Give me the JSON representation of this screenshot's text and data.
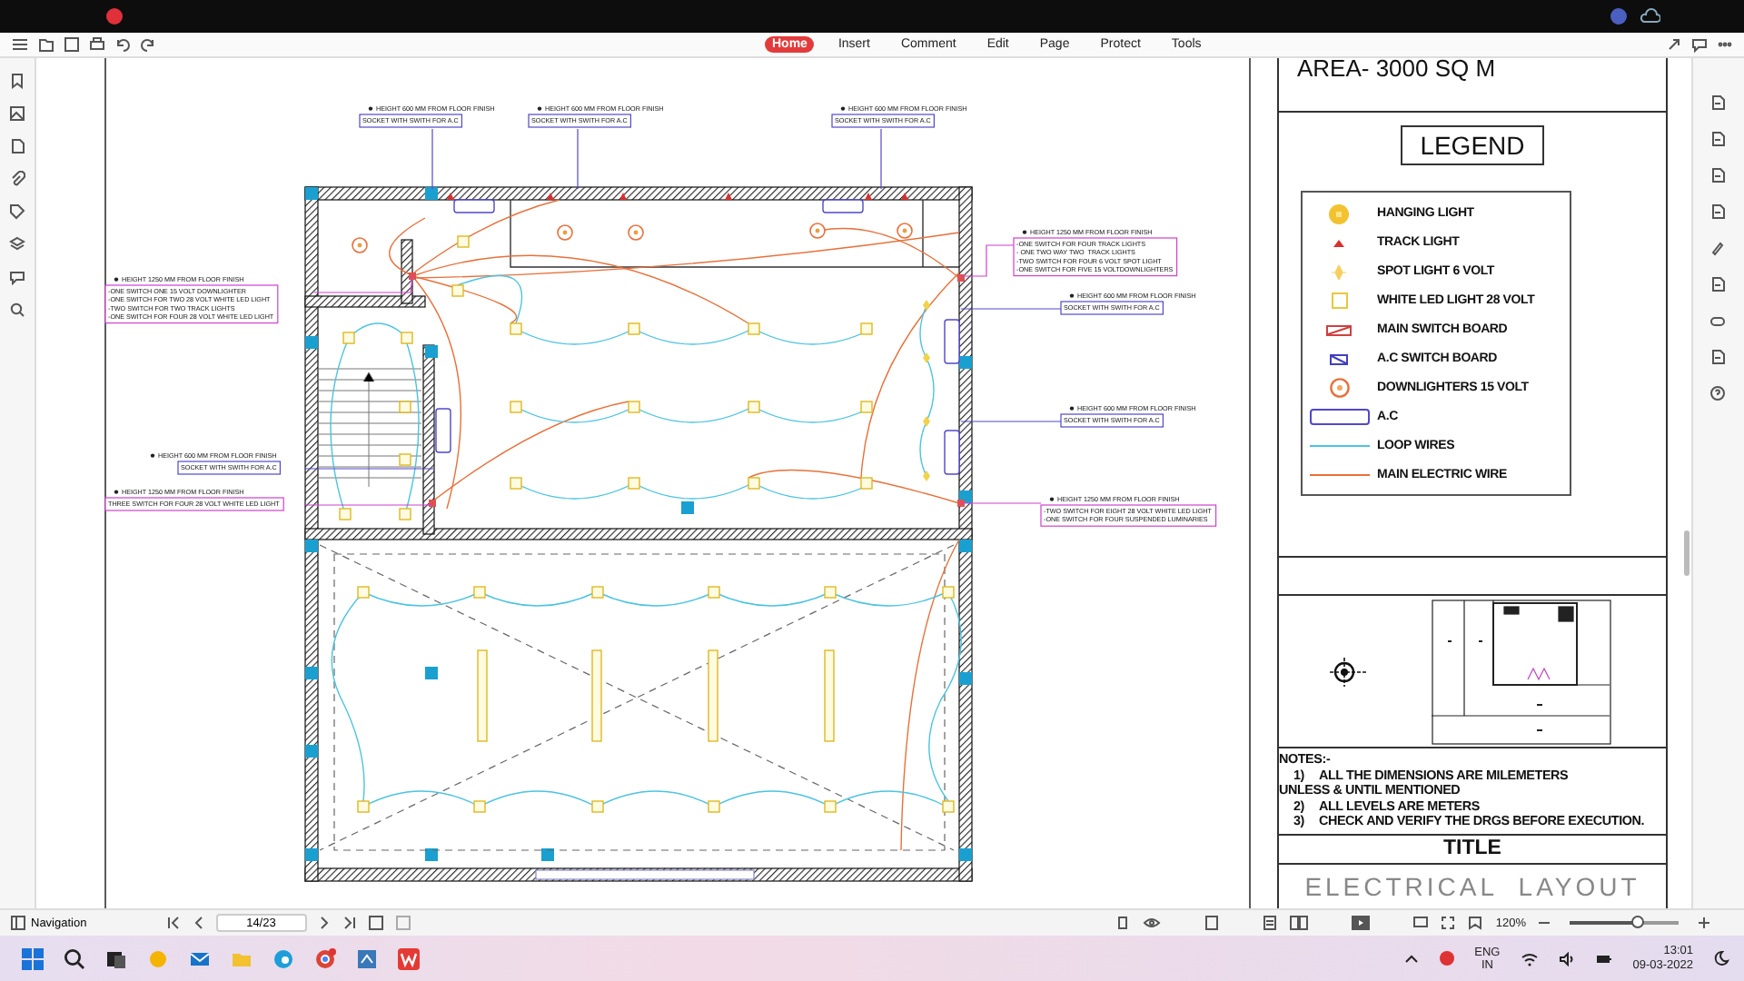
{
  "ribbon": {
    "tabs": [
      {
        "label": "Home",
        "selected": true
      },
      {
        "label": "Insert",
        "selected": false
      },
      {
        "label": "Comment",
        "selected": false
      },
      {
        "label": "Edit",
        "selected": false
      },
      {
        "label": "Page",
        "selected": false
      },
      {
        "label": "Protect",
        "selected": false
      },
      {
        "label": "Tools",
        "selected": false
      }
    ]
  },
  "drawing": {
    "annotations": [
      {
        "kind": "switch",
        "heading": "HEIGHT  1250 MM FROM FLOOR FINISH",
        "lines": [
          "-ONE SWITCH ONE 15 VOLT DOWNLIGHTER",
          "-ONE SWITCH FOR TWO 28 VOLT WHITE LED LIGHT",
          "-TWO SWITCH FOR TWO TRACK LIGHTS",
          "-ONE SWITCH FOR FOUR 28 VOLT WHITE LED LIGHT"
        ]
      },
      {
        "kind": "socket",
        "heading": "HEIGHT 600 MM FROM FLOOR FINISH",
        "lines": [
          "SOCKET WITH SWITH FOR A.C"
        ]
      },
      {
        "kind": "switch",
        "heading": "HEIGHT 1250 MM FROM FLOOR FINISH",
        "lines": [
          "THREE SWITCH FOR FOUR 28 VOLT WHITE LED LIGHT"
        ]
      },
      {
        "kind": "socket",
        "heading": "HEIGHT 600 MM FROM FLOOR FINISH",
        "lines": [
          "SOCKET WITH SWITH FOR A.C"
        ]
      },
      {
        "kind": "socket",
        "heading": "HEIGHT 600 MM FROM FLOOR FINISH",
        "lines": [
          "SOCKET WITH SWITH FOR A.C"
        ]
      },
      {
        "kind": "socket",
        "heading": "HEIGHT 600 MM FROM FLOOR FINISH",
        "lines": [
          "SOCKET WITH SWITH FOR A.C"
        ]
      },
      {
        "kind": "switch",
        "heading": "HEIGHT 1250 MM FROM FLOOR FINISH",
        "lines": [
          "-ONE SWITCH FOR FOUR TRACK LIGHTS",
          "- ONE TWO WAY TWO  TRACK LIGHTS",
          "-TWO SWITCH FOR FOUR 6 VOLT SPOT LIGHT",
          "-ONE SWITCH FOR FIVE 15 VOLTDOWNLIGHTERS"
        ]
      },
      {
        "kind": "socket",
        "heading": "HEIGHT 600 MM FROM FLOOR FINISH",
        "lines": [
          "SOCKET WITH SWITH FOR A.C"
        ]
      },
      {
        "kind": "socket",
        "heading": "HEIGHT 600 MM FROM FLOOR FINISH",
        "lines": [
          "SOCKET WITH SWITH FOR A.C"
        ]
      },
      {
        "kind": "switch",
        "heading": "HEIGHT 1250 MM FROM FLOOR FINISH",
        "lines": [
          "-TWO SWITCH FOR EIGHT 28 VOLT WHITE LED LIGHT",
          "-ONE SWITCH FOR FOUR SUSPENDED LUMINARIES"
        ]
      }
    ]
  },
  "title_block": {
    "area": "AREA- 3000 SQ M",
    "legend_title": "LEGEND",
    "legend": [
      {
        "kind": "hanging-light",
        "label": "HANGING LIGHT"
      },
      {
        "kind": "track-light",
        "label": "TRACK LIGHT"
      },
      {
        "kind": "spot-light",
        "label": "SPOT LIGHT 6 VOLT"
      },
      {
        "kind": "led-light",
        "label": "WHITE LED LIGHT  28 VOLT"
      },
      {
        "kind": "main-switch-board",
        "label": "MAIN SWITCH BOARD"
      },
      {
        "kind": "ac-switch-board",
        "label": "A.C SWITCH BOARD"
      },
      {
        "kind": "downlighter",
        "label": "DOWNLIGHTERS 15 VOLT"
      },
      {
        "kind": "ac",
        "label": "A.C"
      },
      {
        "kind": "loop-wire",
        "label": "LOOP WIRES"
      },
      {
        "kind": "main-wire",
        "label": "MAIN ELECTRIC WIRE"
      }
    ],
    "notes_title": "NOTES:-",
    "notes": [
      {
        "number": "1)",
        "text": "ALL THE DIMENSIONS ARE MILEMETERS"
      },
      {
        "text": "UNLESS & UNTIL MENTIONED"
      },
      {
        "number": "2)",
        "text": "ALL LEVELS ARE METERS"
      },
      {
        "number": "3)",
        "text": "CHECK AND VERIFY THE DRGS BEFORE EXECUTION."
      }
    ],
    "title_label": "TITLE",
    "title": "ELECTRICAL  LAYOUT"
  },
  "status_bar": {
    "navigation": "Navigation",
    "page": "14/23",
    "zoom": "120%",
    "zoom_slider": {
      "level": 0.62
    }
  },
  "taskbar": {
    "language": "ENG",
    "region": "IN",
    "time": "13:01",
    "date": "09-03-2022"
  }
}
